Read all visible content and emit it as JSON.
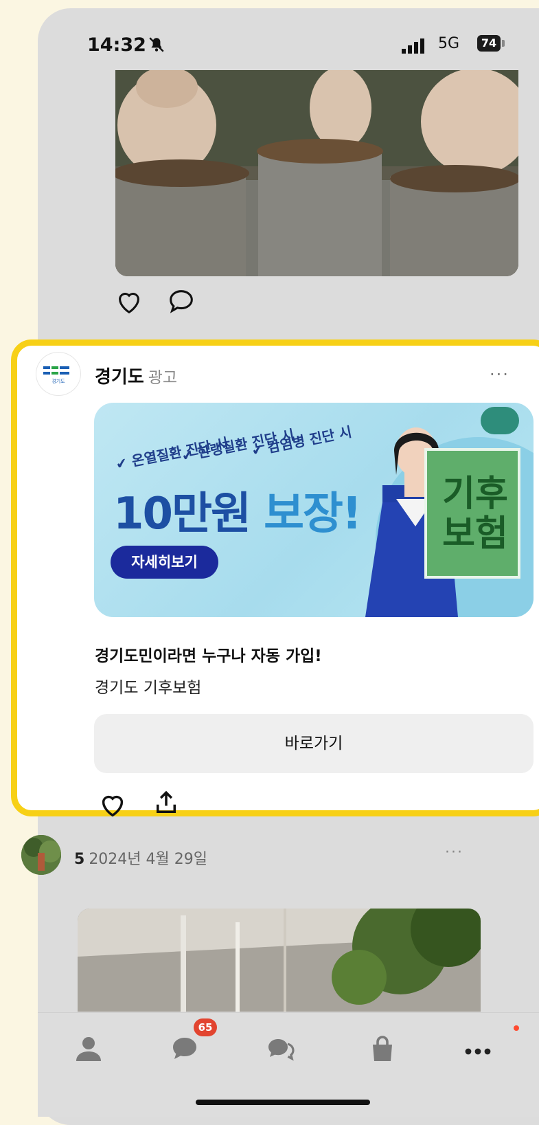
{
  "status_bar": {
    "time": "14:32",
    "network": "5G",
    "battery": "74"
  },
  "ad": {
    "advertiser": "경기도",
    "ad_label": "광고",
    "more": "···",
    "logo_text": "경기도",
    "banner": {
      "line1": "✔ 온열질환 진단 시",
      "line2": "✔ 한랭질환 진단 시",
      "line3": "✔ 감염병 진단 시",
      "amount": "10만원",
      "guarantee": "보장!",
      "button": "자세히보기",
      "poster_title": "기후보험"
    },
    "headline": "경기도민이라면 누구나 자동 가입!",
    "subtitle": "경기도 기후보험",
    "cta": "바로가기"
  },
  "next_post": {
    "number": "5",
    "date": "2024년 4월 29일",
    "more": "···"
  },
  "tabbar": {
    "chat_badge": "65"
  },
  "colors": {
    "highlight": "#f7d016",
    "banner_button": "#1b2a9c",
    "badge": "#e2442f"
  }
}
